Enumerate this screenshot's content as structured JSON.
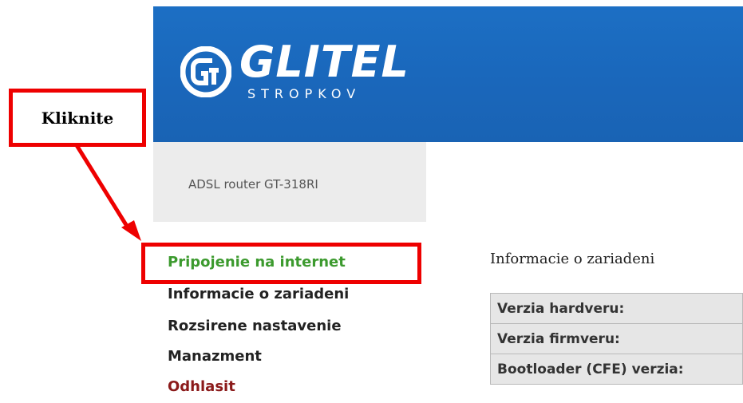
{
  "header": {
    "brand_name": "GLITEL",
    "brand_sub": "STROPKOV",
    "logo_icon": "glitel-logo-mark",
    "brand_color": "#1a67bb"
  },
  "sidebar": {
    "model": "ADSL router GT-318RI",
    "items": [
      {
        "label": "Pripojenie na internet",
        "color": "#3c9a2e"
      },
      {
        "label": "Informacie o zariadeni",
        "color": "#222222"
      },
      {
        "label": "Rozsirene nastavenie",
        "color": "#222222"
      },
      {
        "label": "Manazment",
        "color": "#222222"
      },
      {
        "label": "Odhlasit",
        "color": "#8b1a1a"
      }
    ]
  },
  "main": {
    "section_title": "Informacie o zariadeni",
    "rows": [
      {
        "label": "Verzia hardveru:"
      },
      {
        "label": "Verzia firmveru:"
      },
      {
        "label": "Bootloader (CFE) verzia:"
      }
    ]
  },
  "annotation": {
    "callout_text": "Kliknite",
    "color": "#ee0000"
  }
}
